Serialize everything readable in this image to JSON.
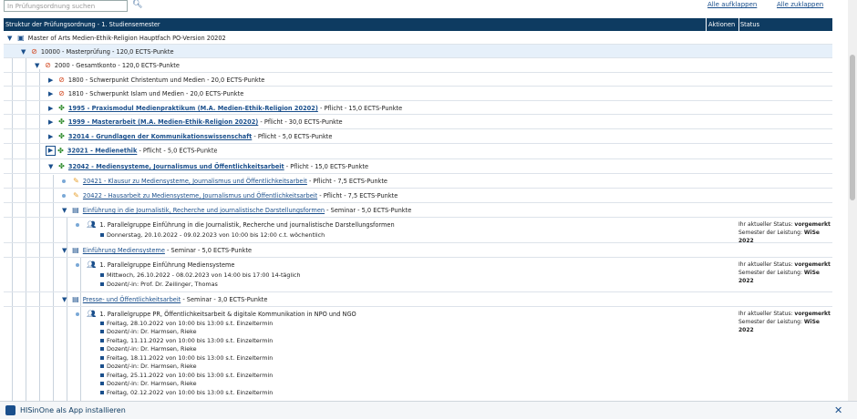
{
  "search": {
    "placeholder": "In Prüfungsordnung suchen"
  },
  "toolbar": {
    "expand_all": "Alle aufklappen",
    "collapse_all": "Alle zuklappen"
  },
  "header": {
    "structure": "Struktur der Prüfungsordnung - 1. Studiensemester",
    "actions": "Aktionen",
    "status": "Status"
  },
  "rows": {
    "r0": {
      "text": "Master of Arts Medien-Ethik-Religion Hauptfach PO-Version 20202"
    },
    "r1": {
      "text": "10000 - Masterprüfung - 120,0 ECTS-Punkte"
    },
    "r2": {
      "text": "2000 - Gesamtkonto - 120,0 ECTS-Punkte"
    },
    "r3": {
      "text": "1800 - Schwerpunkt Christentum und Medien - 20,0 ECTS-Punkte"
    },
    "r4": {
      "text": "1810 - Schwerpunkt Islam und Medien - 20,0 ECTS-Punkte"
    },
    "r5": {
      "link": "1995 - Praxismodul Medienpraktikum (M.A. Medien-Ethik-Religion 20202)",
      "suffix": " - Pflicht - 15,0 ECTS-Punkte"
    },
    "r6": {
      "link": "1999 - Masterarbeit (M.A. Medien-Ethik-Religion 20202)",
      "suffix": " - Pflicht - 30,0 ECTS-Punkte"
    },
    "r7": {
      "link": "32014 - Grundlagen der Kommunikationswissenschaft",
      "suffix": " - Pflicht - 5,0 ECTS-Punkte"
    },
    "r8": {
      "link": "32021 - Medienethik",
      "suffix": " - Pflicht - 5,0 ECTS-Punkte"
    },
    "r9": {
      "link": "32042 - Mediensysteme, Journalismus und Öffentlichkeitsarbeit",
      "suffix": " - Pflicht - 15,0 ECTS-Punkte"
    },
    "r10": {
      "link": "20421 - Klausur zu Mediensysteme, Journalismus und Öffentlichkeitsarbeit",
      "suffix": " - Pflicht - 7,5 ECTS-Punkte"
    },
    "r11": {
      "link": "20422 - Hausarbeit zu Mediensysteme, Journalismus und Öffentlichkeitsarbeit",
      "suffix": " - Pflicht - 7,5 ECTS-Punkte"
    },
    "r12": {
      "link": "Einführung in die Journalistik, Recherche und journalistische Darstellungsformen",
      "suffix": " - Seminar - 5,0 ECTS-Punkte"
    },
    "r13": {
      "group": "1. Parallelgruppe Einführung in die Journalistik, Recherche und journalistische Darstellungsformen",
      "line1": "Donnerstag, 20.10.2022 - 09.02.2023 von 10:00 bis 12:00 c.t. wöchentlich",
      "status_label": "Ihr aktueller Status:",
      "status_value": "vorgemerkt",
      "sem_label": "Semester der Leistung:",
      "sem_value": "WiSe 2022"
    },
    "r14": {
      "link": "Einführung Mediensysteme",
      "suffix": " - Seminar - 5,0 ECTS-Punkte"
    },
    "r15": {
      "group": "1. Parallelgruppe Einführung Mediensysteme",
      "line1": "Mittwoch, 26.10.2022 - 08.02.2023 von 14:00 bis 17:00 14-täglich",
      "line2_label": "Dozent/-in:",
      "line2_value": "Prof. Dr. Zeilinger, Thomas",
      "status_label": "Ihr aktueller Status:",
      "status_value": "vorgemerkt",
      "sem_label": "Semester der Leistung:",
      "sem_value": "WiSe 2022"
    },
    "r16": {
      "link": "Presse- und Öffentlichkeitsarbeit",
      "suffix": " - Seminar - 3,0 ECTS-Punkte"
    },
    "r17": {
      "group": "1. Parallelgruppe PR, Öffentlichkeitsarbeit & digitale Kommunikation in NPO und NGO",
      "status_label": "Ihr aktueller Status:",
      "status_value": "vorgemerkt",
      "sem_label": "Semester der Leistung:",
      "sem_value": "WiSe 2022",
      "dates": [
        "Freitag, 28.10.2022 von 10:00 bis 13:00 s.t. Einzeltermin",
        "Freitag, 11.11.2022 von 10:00 bis 13:00 s.t. Einzeltermin",
        "Freitag, 18.11.2022 von 10:00 bis 13:00 s.t. Einzeltermin",
        "Freitag, 25.11.2022 von 10:00 bis 13:00 s.t. Einzeltermin",
        "Freitag, 02.12.2022 von 10:00 bis 13:00 s.t. Einzeltermin"
      ],
      "dozent_label": "Dozent/-in:",
      "dozent_value": "Dr. Harmsen, Rieke"
    }
  },
  "footer": {
    "install": "HISinOne als App installieren"
  },
  "colors": {
    "header_bg": "#0e3b61",
    "link": "#1a4f8c",
    "highlight": "#e6f0fa"
  }
}
